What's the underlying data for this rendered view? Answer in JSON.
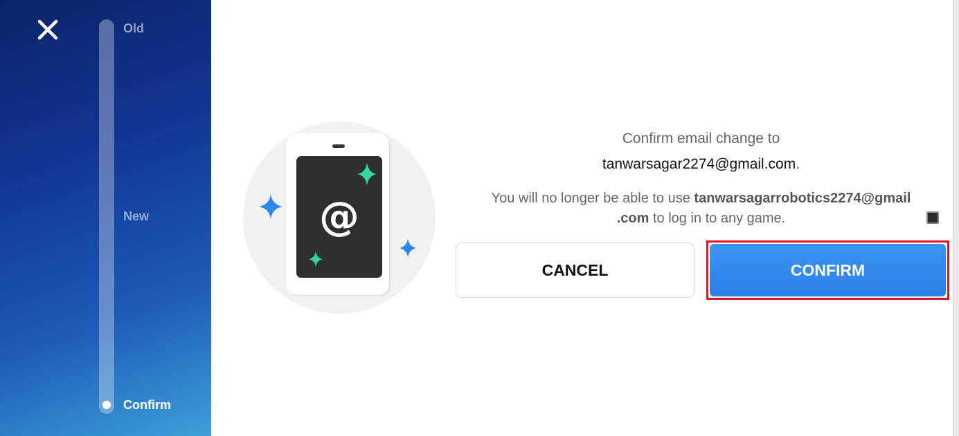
{
  "sidebar": {
    "close_icon": "close-icon",
    "steps": [
      {
        "label": "Old",
        "state": "done"
      },
      {
        "label": "New",
        "state": "done"
      },
      {
        "label": "Confirm",
        "state": "current"
      }
    ],
    "progress_step_index": 3
  },
  "illustration": {
    "symbol": "@",
    "icon": "phone-email-icon"
  },
  "dialog": {
    "prompt": "Confirm email change to",
    "new_email": "tanwarsagar2274@gmail.com",
    "period": ".",
    "warning_prefix": "You will no longer be able to use ",
    "old_email_part1": "tanwarsagarrobotics2274@gmail",
    "old_email_part2": ".com",
    "warning_suffix": " to log in to any game."
  },
  "buttons": {
    "cancel": "CANCEL",
    "confirm": "CONFIRM"
  },
  "colors": {
    "accent": "#2b82ea",
    "highlight": "#e0141f",
    "sidebar_dark": "#0a2468",
    "sidebar_light": "#3da0d8",
    "sparkle_green": "#2ed89a",
    "sparkle_blue": "#2e86f0"
  }
}
